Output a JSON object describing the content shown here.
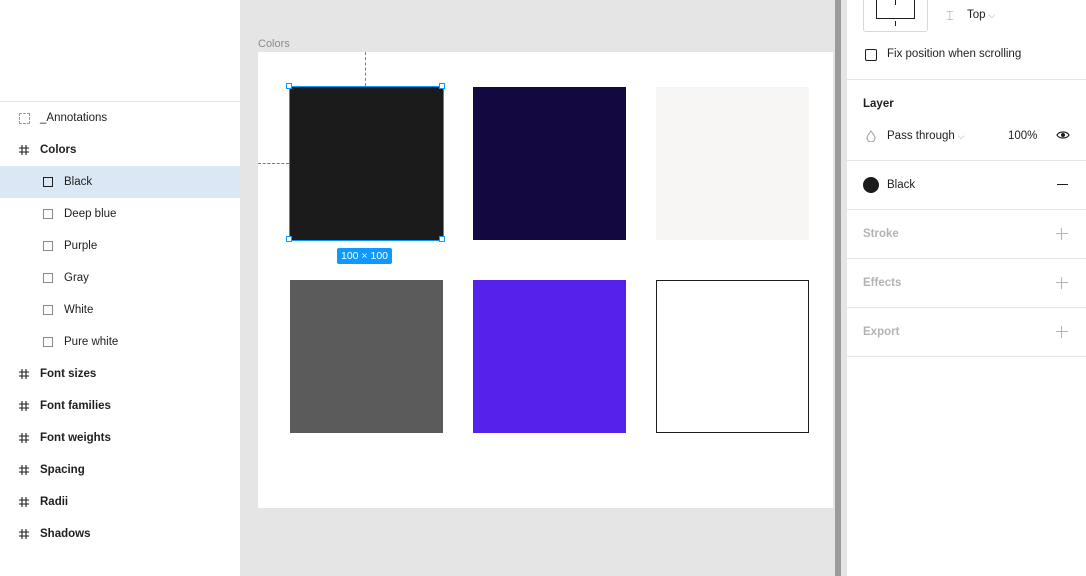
{
  "layers_panel": {
    "items": [
      {
        "label": "_Annotations",
        "kind": "annotation"
      },
      {
        "label": "Colors",
        "kind": "frame"
      },
      {
        "label": "Black",
        "kind": "rect",
        "selected": true
      },
      {
        "label": "Deep blue",
        "kind": "rect"
      },
      {
        "label": "Purple",
        "kind": "rect"
      },
      {
        "label": "Gray",
        "kind": "rect"
      },
      {
        "label": "White",
        "kind": "rect"
      },
      {
        "label": "Pure white",
        "kind": "rect"
      },
      {
        "label": "Font sizes",
        "kind": "frame"
      },
      {
        "label": "Font families",
        "kind": "frame"
      },
      {
        "label": "Font weights",
        "kind": "frame"
      },
      {
        "label": "Spacing",
        "kind": "frame"
      },
      {
        "label": "Radii",
        "kind": "frame"
      },
      {
        "label": "Shadows",
        "kind": "frame"
      }
    ]
  },
  "canvas": {
    "frame_label": "Colors",
    "selection_size": "100 × 100",
    "swatches": [
      {
        "name": "Black",
        "color": "#1c1b1b"
      },
      {
        "name": "Deep blue",
        "color": "#140841"
      },
      {
        "name": "White",
        "color": "#f7f6f5"
      },
      {
        "name": "Gray",
        "color": "#5b5b5b"
      },
      {
        "name": "Purple",
        "color": "#5621ea"
      },
      {
        "name": "Pure white",
        "color": "#ffffff"
      }
    ],
    "accent": "#0d99ff"
  },
  "properties": {
    "constraint_vertical": "Top",
    "fix_position_label": "Fix position when scrolling",
    "layer_title": "Layer",
    "blend_mode": "Pass through",
    "opacity": "100%",
    "fill_style_name": "Black",
    "fill_color": "#1c1b1b",
    "stroke_title": "Stroke",
    "effects_title": "Effects",
    "export_title": "Export"
  }
}
